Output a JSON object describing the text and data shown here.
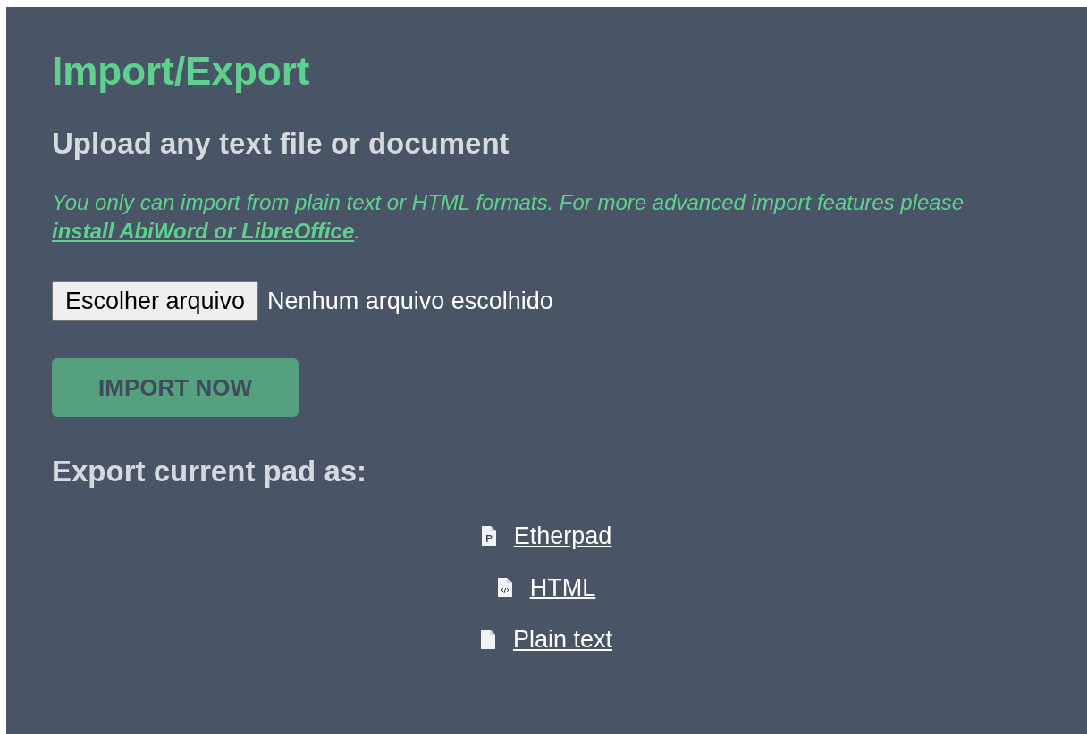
{
  "title": "Import/Export",
  "import": {
    "heading": "Upload any text file or document",
    "note_before": "You only can import from plain text or HTML formats. For more advanced import features please ",
    "note_link": "install AbiWord or LibreOffice",
    "note_after": ".",
    "file_button": "Escolher arquivo",
    "file_status": "Nenhum arquivo escolhido",
    "import_button": {
      "label": "IMPORT NOW",
      "disabled": true
    }
  },
  "export": {
    "heading": "Export current pad as:",
    "formats": [
      {
        "kind": "etherpad",
        "label": "Etherpad"
      },
      {
        "kind": "html",
        "label": "HTML"
      },
      {
        "kind": "text",
        "label": "Plain text"
      }
    ]
  }
}
